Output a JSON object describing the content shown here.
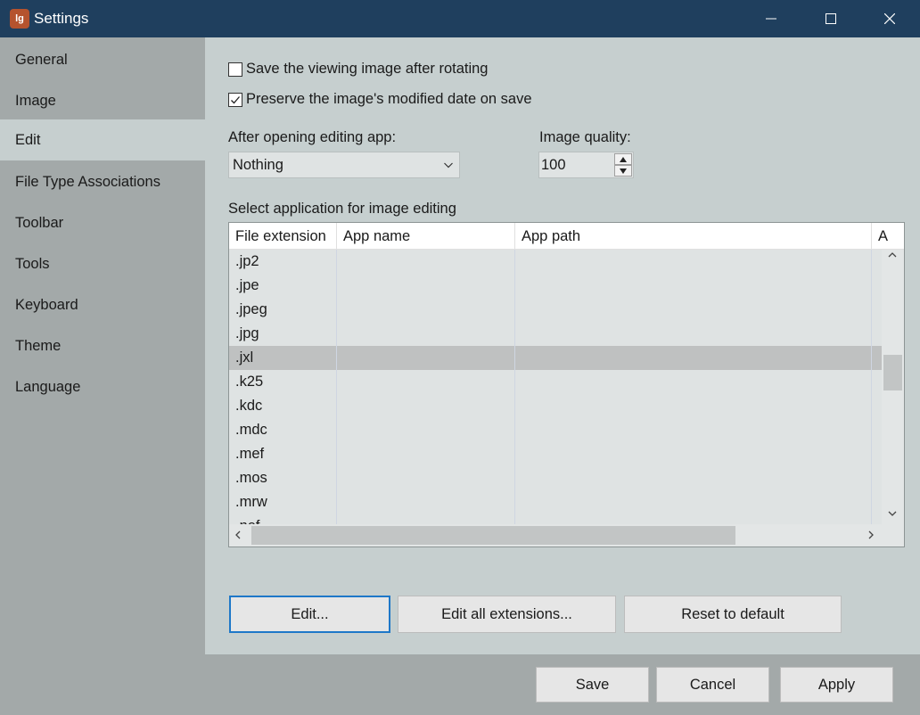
{
  "window": {
    "title": "Settings",
    "icon_text": "lg"
  },
  "sidebar": {
    "items": [
      {
        "label": "General"
      },
      {
        "label": "Image"
      },
      {
        "label": "Edit"
      },
      {
        "label": "File Type Associations"
      },
      {
        "label": "Toolbar"
      },
      {
        "label": "Tools"
      },
      {
        "label": "Keyboard"
      },
      {
        "label": "Theme"
      },
      {
        "label": "Language"
      }
    ],
    "active": "Edit"
  },
  "edit": {
    "save_after_rotating": {
      "label": "Save the viewing image after rotating",
      "checked": false
    },
    "preserve_modified_date": {
      "label": "Preserve the image's modified date on save",
      "checked": true
    },
    "after_opening_label": "After opening editing app:",
    "after_opening_value": "Nothing",
    "image_quality_label": "Image quality:",
    "image_quality_value": "100",
    "select_app_label": "Select application for image editing",
    "table": {
      "headers": [
        "File extension",
        "App name",
        "App path",
        "A"
      ],
      "rows": [
        ".jp2",
        ".jpe",
        ".jpeg",
        ".jpg",
        ".jxl",
        ".k25",
        ".kdc",
        ".mdc",
        ".mef",
        ".mos",
        ".mrw",
        ".nef"
      ],
      "selected_row": ".jxl"
    },
    "buttons": {
      "edit": "Edit...",
      "edit_all": "Edit all extensions...",
      "reset": "Reset to default"
    }
  },
  "footer": {
    "save": "Save",
    "cancel": "Cancel",
    "apply": "Apply"
  }
}
